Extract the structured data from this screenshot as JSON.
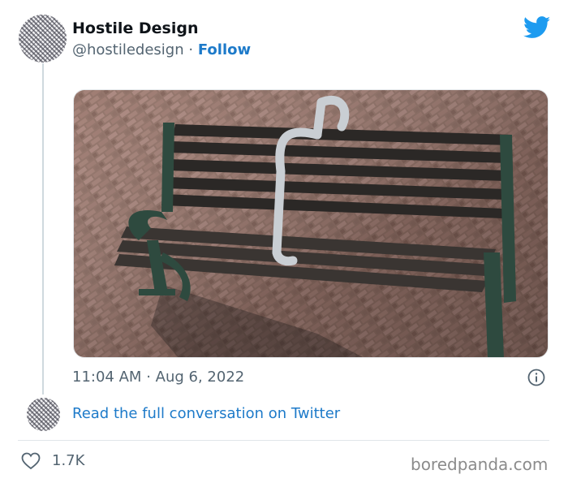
{
  "tweet": {
    "author_name": "Hostile Design",
    "handle": "@hostiledesign",
    "separator": "·",
    "follow_label": "Follow",
    "time": "11:04 AM",
    "date": "Aug 6, 2022",
    "read_more": "Read the full conversation on Twitter",
    "likes": "1.7K"
  },
  "icons": {
    "brand": "twitter-bird-icon",
    "info": "info-icon",
    "like": "heart-icon"
  },
  "colors": {
    "link": "#1d7ac9",
    "twitter_blue": "#1d9bf0",
    "muted": "#536471"
  },
  "watermark": "boredpanda.com"
}
